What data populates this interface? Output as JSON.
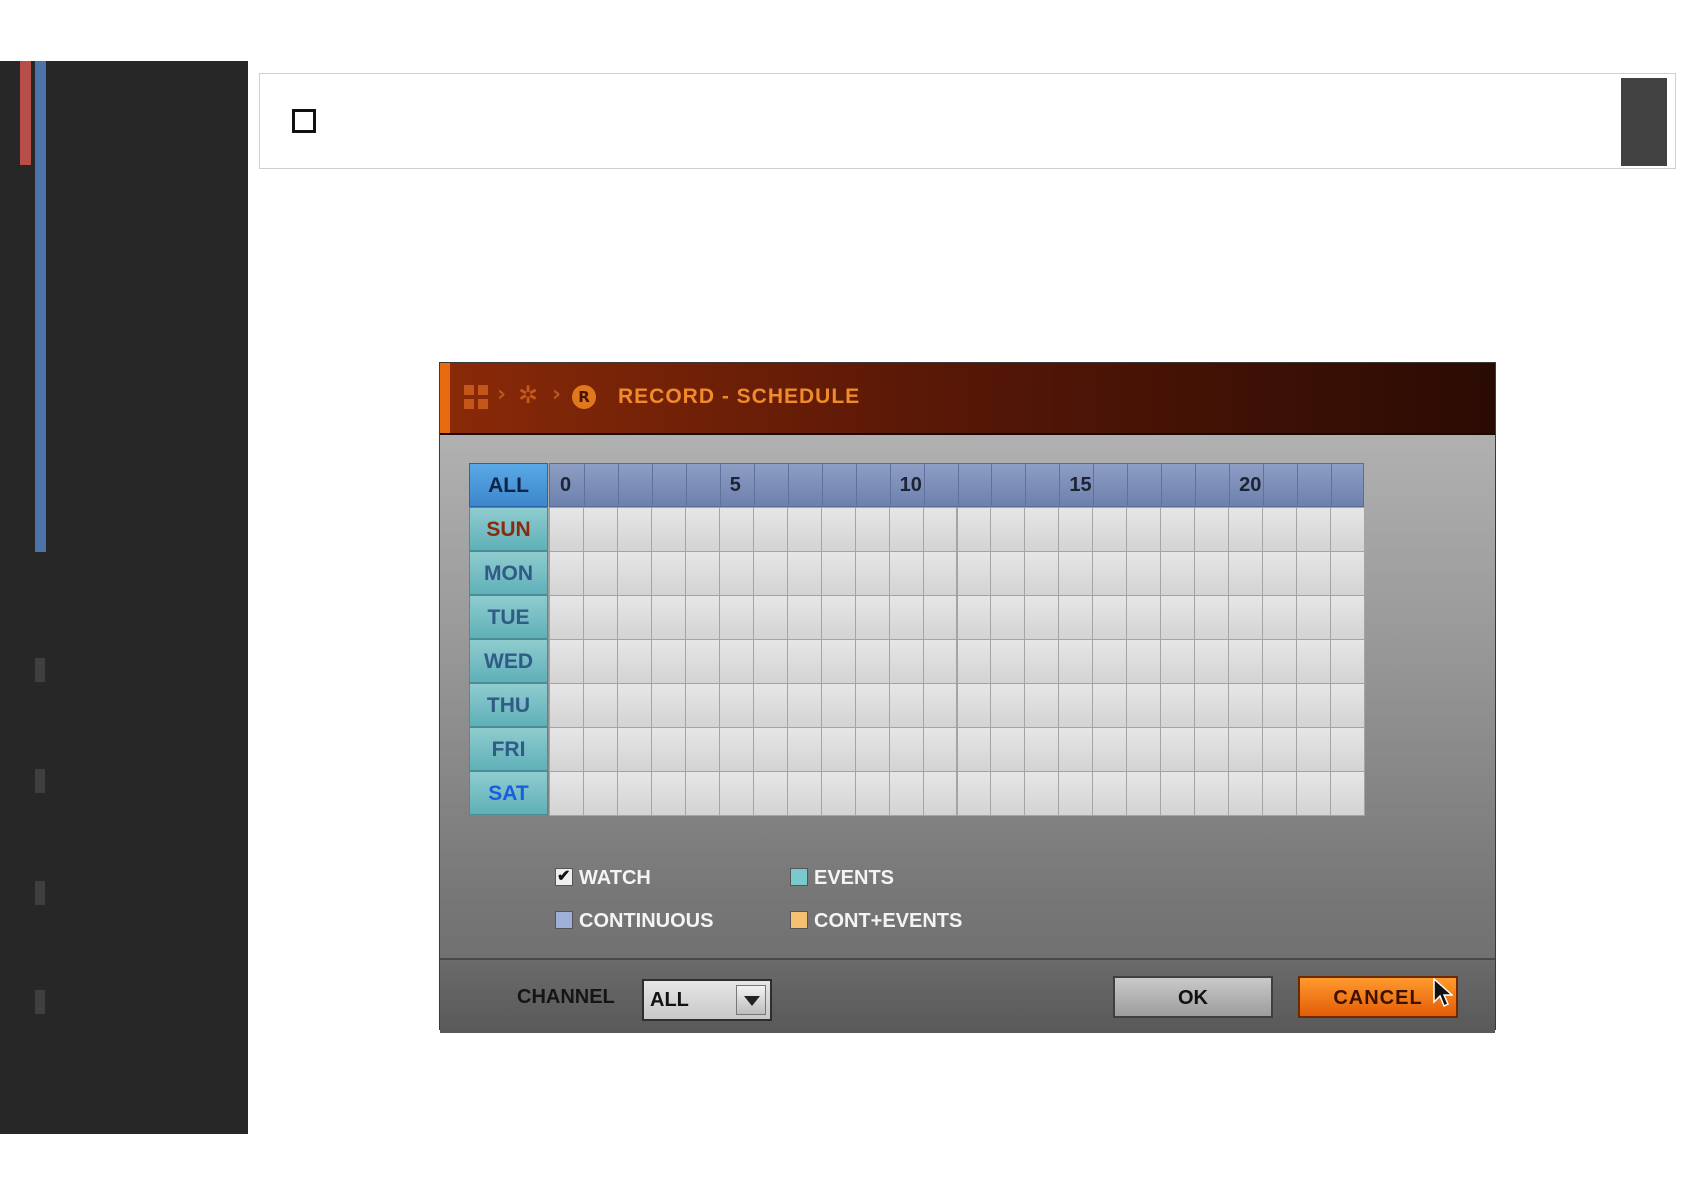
{
  "dialog": {
    "title": "RECORD - SCHEDULE",
    "all_label": "ALL",
    "hour_labels": [
      {
        "hour": 0,
        "text": "0"
      },
      {
        "hour": 5,
        "text": "5"
      },
      {
        "hour": 10,
        "text": "10"
      },
      {
        "hour": 15,
        "text": "15"
      },
      {
        "hour": 20,
        "text": "20"
      }
    ],
    "hours_per_day": 24,
    "days": [
      {
        "label": "SUN",
        "color": "#8b2a10"
      },
      {
        "label": "MON",
        "color": "#2f5b86"
      },
      {
        "label": "TUE",
        "color": "#2f5b86"
      },
      {
        "label": "WED",
        "color": "#2f5b86"
      },
      {
        "label": "THU",
        "color": "#2f5b86"
      },
      {
        "label": "FRI",
        "color": "#2f5b86"
      },
      {
        "label": "SAT",
        "color": "#1a5ee0"
      }
    ],
    "legend": {
      "watch": {
        "label": "WATCH",
        "checked": true
      },
      "events": {
        "label": "EVENTS",
        "color": "#7cc8cf"
      },
      "continuous": {
        "label": "CONTINUOUS",
        "color": "#9fb0d8"
      },
      "cont_events": {
        "label": "CONT+EVENTS",
        "color": "#f4c071"
      }
    },
    "channel": {
      "label": "CHANNEL",
      "value": "ALL"
    },
    "ok_label": "OK",
    "cancel_label": "CANCEL"
  },
  "colors": {
    "title_text": "#f08a2a",
    "accent_orange": "#e86b10",
    "cell_bg": "#dcdcdc",
    "hour_header_bg": "#7d90bb"
  },
  "icons": [
    "grid-icon",
    "chevron-right-icon",
    "gear-icon",
    "record-icon",
    "chevron-down-icon",
    "mouse-cursor-icon"
  ]
}
